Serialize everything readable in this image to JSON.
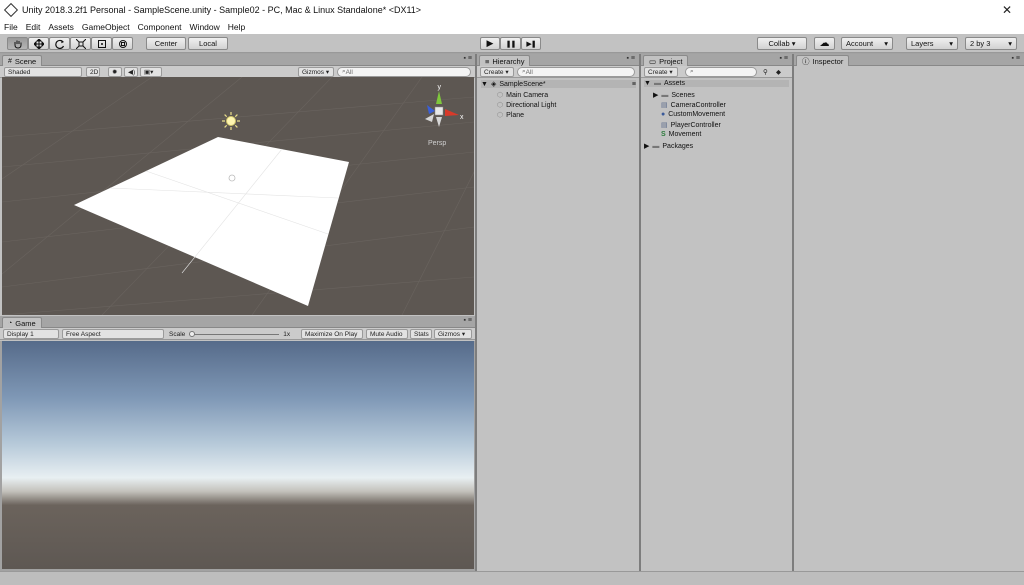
{
  "window": {
    "title": "Unity 2018.3.2f1 Personal - SampleScene.unity - Sample02 - PC, Mac & Linux Standalone* <DX11>",
    "close": "✕"
  },
  "menu": [
    "File",
    "Edit",
    "Assets",
    "GameObject",
    "Component",
    "Window",
    "Help"
  ],
  "toolbar": {
    "pivot": "Center",
    "space": "Local",
    "play_icon": "▶",
    "pause_icon": "❚❚",
    "step_icon": "▶❚",
    "collab": "Collab ▾",
    "cloud_icon": "☁",
    "account": "Account",
    "layers": "Layers",
    "layout": "2 by 3",
    "dropdown_arrow": "▾"
  },
  "scene": {
    "tab": "Scene",
    "shading": "Shaded",
    "mode2d": "2D",
    "gizmos": "Gizmos ▾",
    "search_placeholder": "All",
    "persp": "Persp",
    "axis_y": "y",
    "axis_x": "x"
  },
  "game": {
    "tab": "Game",
    "display": "Display 1",
    "aspect": "Free Aspect",
    "scale_label": "Scale",
    "scale_value": "1x",
    "maximize": "Maximize On Play",
    "mute": "Mute Audio",
    "stats": "Stats",
    "gizmos": "Gizmos ▾"
  },
  "hierarchy": {
    "tab": "Hierarchy",
    "create": "Create ▾",
    "search_placeholder": "All",
    "scene_name": "SampleScene*",
    "items": [
      "Main Camera",
      "Directional Light",
      "Plane"
    ]
  },
  "project": {
    "tab": "Project",
    "create": "Create ▾",
    "assets": "Assets",
    "scenes": "Scenes",
    "files": [
      "CameraController",
      "CustomMovement",
      "PlayerController",
      "Movement"
    ],
    "packages": "Packages"
  },
  "inspector": {
    "tab": "Inspector"
  },
  "colors": {
    "scene_bg": "#5d5752",
    "panel": "#c2c2c2",
    "gizmo_x": "#d83a2a",
    "gizmo_y": "#7fc83c",
    "gizmo_z": "#3a5fd8"
  }
}
